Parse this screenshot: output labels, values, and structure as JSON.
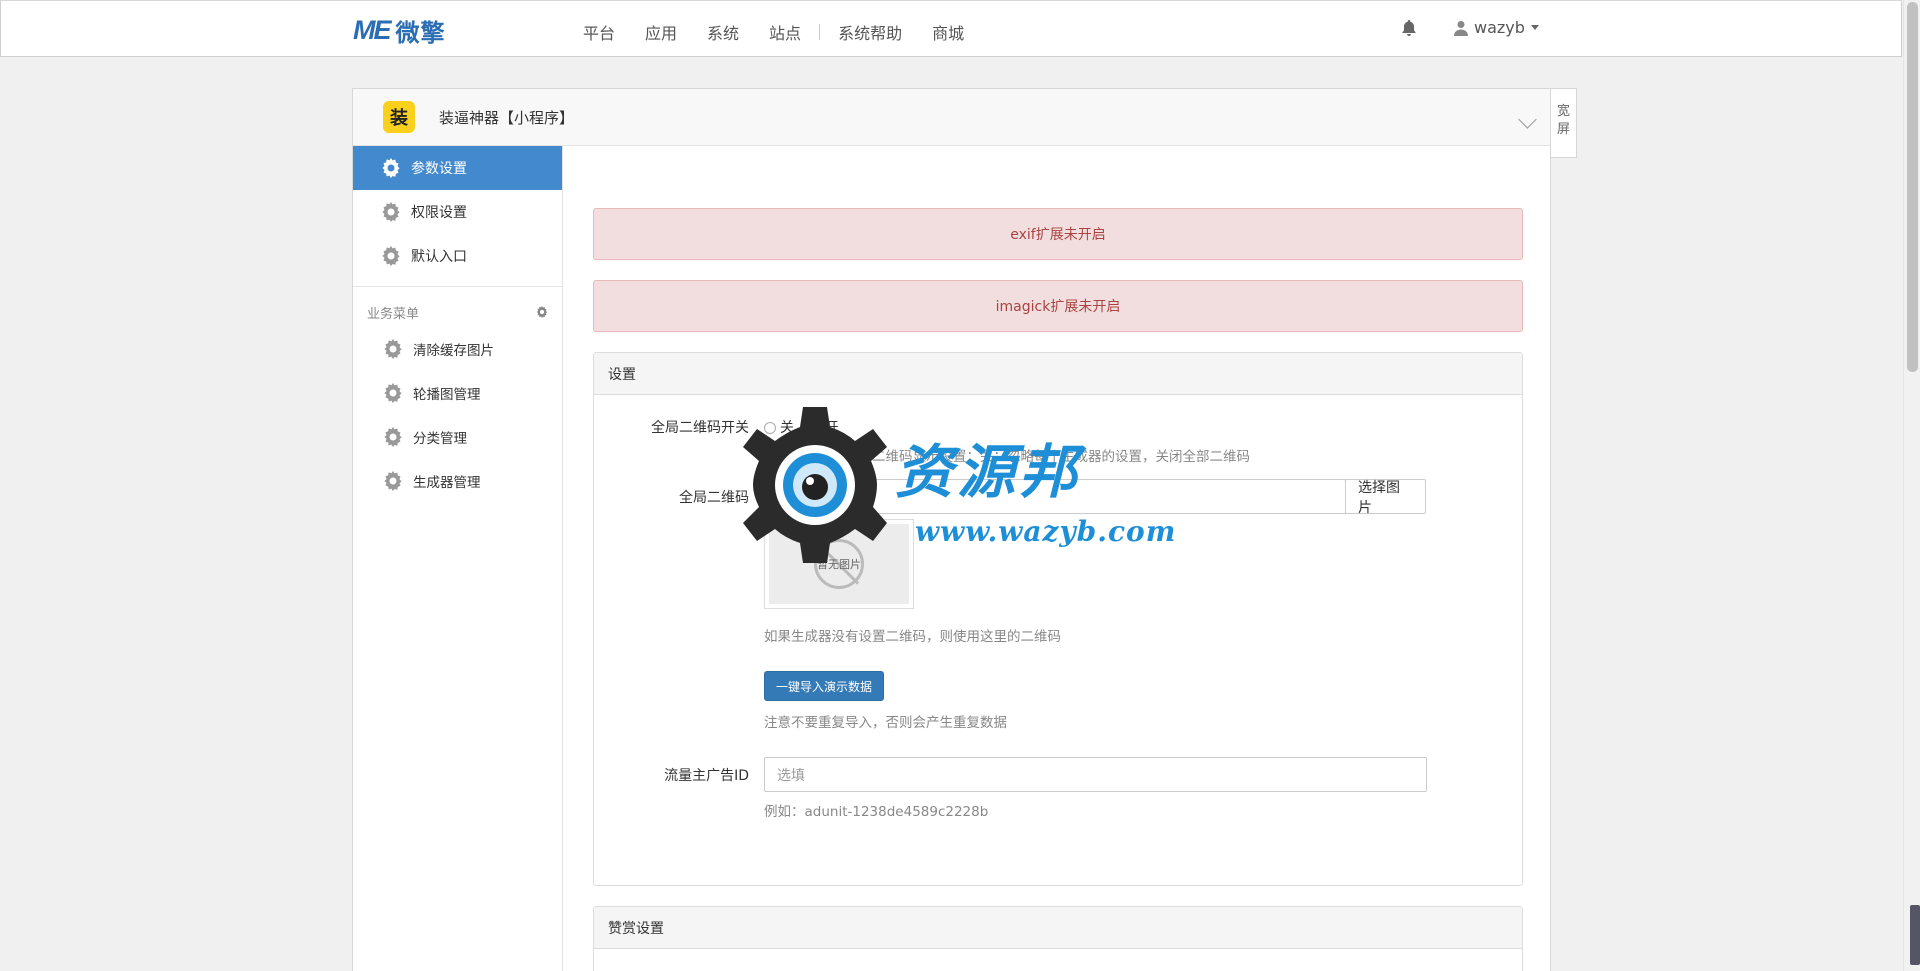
{
  "topbar": {
    "logo_mark": "ME",
    "logo_text": "微擎",
    "nav": [
      "平台",
      "应用",
      "系统",
      "站点",
      "系统帮助",
      "商城"
    ],
    "username": "wazyb"
  },
  "app": {
    "icon_text": "装",
    "title": "装逼神器【小程序】",
    "wide_toggle": "宽屏"
  },
  "sidebar": {
    "items": [
      {
        "label": "参数设置",
        "active": true
      },
      {
        "label": "权限设置"
      },
      {
        "label": "默认入口"
      }
    ],
    "group_title": "业务菜单",
    "sub_items": [
      {
        "label": "清除缓存图片"
      },
      {
        "label": "轮播图管理"
      },
      {
        "label": "分类管理"
      },
      {
        "label": "生成器管理"
      }
    ]
  },
  "alerts": [
    "exif扩展未开启",
    "imagick扩展未开启"
  ],
  "settings": {
    "title": "设置",
    "qr_switch_label": "全局二维码开关",
    "qr_switch_options": [
      "关",
      "开"
    ],
    "qr_switch_help": "开：按照生成器的二维码显示设置；关：忽略每个生成器的设置，关闭全部二维码",
    "qr_label": "全局二维码",
    "select_image_btn": "选择图片",
    "no_image_text": "暂无图片",
    "qr_help": "如果生成器没有设置二维码，则使用这里的二维码",
    "import_btn": "一键导入演示数据",
    "import_help": "注意不要重复导入，否则会产生重复数据",
    "ad_label": "流量主广告ID",
    "ad_placeholder": "选填",
    "ad_help": "例如：adunit-1238de4589c2228b"
  },
  "reward": {
    "title": "赞赏设置"
  },
  "watermark": {
    "title": "资源邦",
    "url": "www.wazyb.com"
  },
  "colors": {
    "accent": "#4389cd",
    "alert_bg": "#f2dede",
    "alert_text": "#a94442",
    "primary_btn": "#337ab7",
    "watermark_blue": "#1e8fd6"
  }
}
